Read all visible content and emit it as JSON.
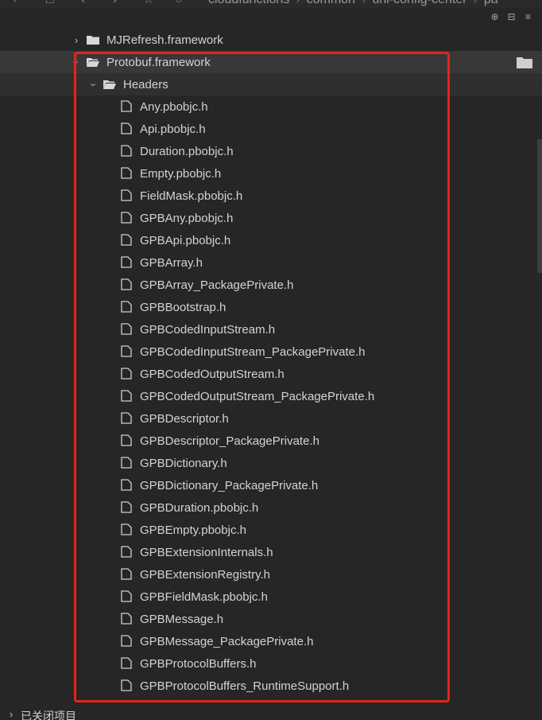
{
  "breadcrumb": [
    "cloudfunctions",
    "common",
    "uni-config-center",
    "pa"
  ],
  "tree": {
    "collapsed_folder": "MJRefresh.framework",
    "selected_folder": "Protobuf.framework",
    "headers_folder": "Headers",
    "files": [
      "Any.pbobjc.h",
      "Api.pbobjc.h",
      "Duration.pbobjc.h",
      "Empty.pbobjc.h",
      "FieldMask.pbobjc.h",
      "GPBAny.pbobjc.h",
      "GPBApi.pbobjc.h",
      "GPBArray.h",
      "GPBArray_PackagePrivate.h",
      "GPBBootstrap.h",
      "GPBCodedInputStream.h",
      "GPBCodedInputStream_PackagePrivate.h",
      "GPBCodedOutputStream.h",
      "GPBCodedOutputStream_PackagePrivate.h",
      "GPBDescriptor.h",
      "GPBDescriptor_PackagePrivate.h",
      "GPBDictionary.h",
      "GPBDictionary_PackagePrivate.h",
      "GPBDuration.pbobjc.h",
      "GPBEmpty.pbobjc.h",
      "GPBExtensionInternals.h",
      "GPBExtensionRegistry.h",
      "GPBFieldMask.pbobjc.h",
      "GPBMessage.h",
      "GPBMessage_PackagePrivate.h",
      "GPBProtocolBuffers.h",
      "GPBProtocolBuffers_RuntimeSupport.h"
    ]
  },
  "footer": {
    "closed_projects_label": "已关闭项目"
  },
  "colors": {
    "background": "#262626",
    "text": "#d3d3d3",
    "highlight": "#e1261c"
  }
}
